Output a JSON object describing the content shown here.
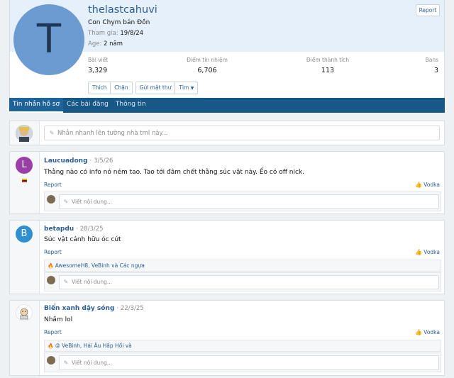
{
  "profile": {
    "avatar_letter": "T",
    "username": "thelastcahuvi",
    "user_title": "Con Chym bán Đồn",
    "joined_label": "Tham gia:",
    "joined_value": "19/8/24",
    "age_label": "Age:",
    "age_value": "2 năm",
    "report_label": "Report",
    "stats": [
      {
        "label": "Bài viết",
        "value": "3,329"
      },
      {
        "label": "Điểm tín nhiệm",
        "value": "6,706"
      },
      {
        "label": "Điểm thành tích",
        "value": "113"
      },
      {
        "label": "Bans",
        "value": "3"
      }
    ],
    "buttons": {
      "like": "Thích",
      "block": "Chặn",
      "message": "Gửi mật thư",
      "find": "Tìm"
    }
  },
  "tabs": [
    "Tin nhắn hồ sơ",
    "Các bài đăng",
    "Thông tin"
  ],
  "composer": {
    "placeholder": "Nhắn nhanh lên tường nhà tml này..."
  },
  "common": {
    "report": "Report",
    "vodka": "Vodka",
    "reply_placeholder": "Viết nội dung...",
    "sep": "·"
  },
  "posts": [
    {
      "avatar_letter": "L",
      "avatar_color": "#9b3fa8",
      "author": "Laucuadong",
      "date": "3/5/26",
      "text": "Thằng nào có info nó ném tao. Tao tới đâm chết thằng súc vật này. Ếo có off nick.",
      "reactions": ""
    },
    {
      "avatar_letter": "B",
      "avatar_color": "#2f8fd1",
      "author": "betapdu",
      "date": "28/3/25",
      "text": "Súc vật cánh hữu óc cứt",
      "reactions": "AwesomeH8, VeBinh và Các ngựa"
    },
    {
      "avatar_letter": "",
      "avatar_color": "#ffffff",
      "author": "Biển xanh dậy sóng",
      "date": "22/3/25",
      "text": "Nhầm lol",
      "reactions": "VeBinh, Hải Âu Hấp Hối và"
    }
  ]
}
